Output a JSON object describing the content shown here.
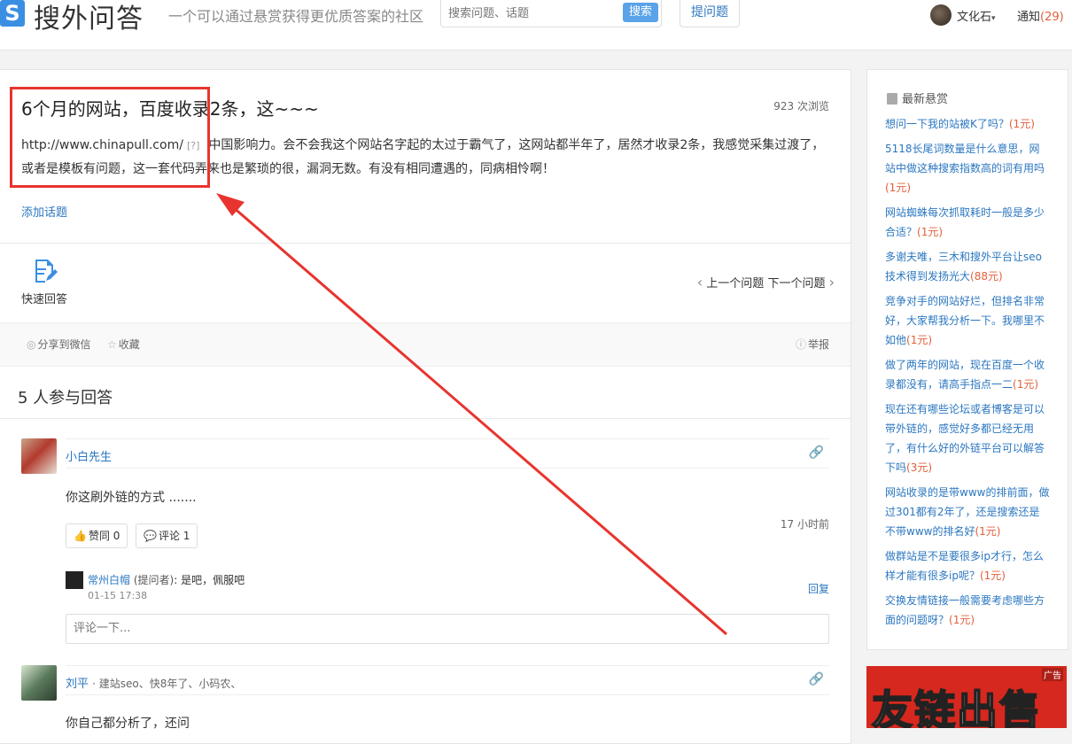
{
  "header": {
    "logo_mark": "S",
    "logo_text": "搜外问答",
    "slogan": "一个可以通过悬赏获得更优质答案的社区",
    "search_placeholder": "搜索问题、话题",
    "search_button": "搜索",
    "ask_button": "提问题",
    "user_name": "文化石",
    "notify_label": "通知",
    "notify_count": "(29)"
  },
  "question": {
    "title": "6个月的网站，百度收录2条，这~~~",
    "views": "923 次浏览",
    "url": "http://www.chinapull.com/",
    "help_tag": "[?]",
    "body": "中国影响力。会不会我这个网站名字起的太过于霸气了，这网站都半年了，居然才收录2条，我感觉采集过渡了，或者是模板有问题，这一套代码弄来也是繁琐的很，漏洞无数。有没有相同遭遇的，同病相怜啊！",
    "add_topic": "添加话题",
    "quick_answer": "快速回答",
    "prev_question": "上一个问题",
    "next_question": "下一个问题",
    "share_wechat": "分享到微信",
    "favorite": "收藏",
    "report": "举报"
  },
  "answers": {
    "count_label": "5 人参与回答",
    "items": [
      {
        "name": "小白先生",
        "text": "你这刷外链的方式 .......",
        "like_label": "赞同 0",
        "comment_label": "评论 1",
        "time": "17 小时前",
        "comment": {
          "name": "常州白帽",
          "role": "(提问者)",
          "text": ": 是吧，佩服吧",
          "time": "01-15 17:38",
          "reply": "回复"
        },
        "comment_placeholder": "评论一下..."
      },
      {
        "name": "刘平",
        "sig": "建站seo、快8年了、小码农、",
        "text": "你自己都分析了，还问"
      }
    ]
  },
  "sidebar": {
    "title": "最新悬赏",
    "items": [
      {
        "text": "想问一下我的站被K了吗？",
        "reward": "(1元)"
      },
      {
        "text": "5118长尾词数量是什么意思，网站中做这种搜索指数高的词有用吗",
        "reward": "(1元)"
      },
      {
        "text": "网站蜘蛛每次抓取耗时一般是多少合适？",
        "reward": "(1元)"
      },
      {
        "text": "多谢夫唯，三木和搜外平台让seo技术得到发扬光大",
        "reward": "(88元)"
      },
      {
        "text": "竞争对手的网站好烂，但排名非常好，大家帮我分析一下。我哪里不如他",
        "reward": "(1元)"
      },
      {
        "text": "做了两年的网站，现在百度一个收录都没有，请高手指点一二",
        "reward": "(1元)"
      },
      {
        "text": "现在还有哪些论坛或者博客是可以带外链的，感觉好多都已经无用了，有什么好的外链平台可以解答下吗",
        "reward": "(3元)"
      },
      {
        "text": "网站收录的是带www的排前面，做过301都有2年了，还是搜索还是不带www的排名好",
        "reward": "(1元)"
      },
      {
        "text": "做群站是不是要很多ip才行，怎么样才能有很多ip呢？",
        "reward": "(1元)"
      },
      {
        "text": "交换友情链接一般需要考虑哪些方面的问题呀？",
        "reward": "(1元)"
      }
    ],
    "ad_text": "友链出售",
    "ad_tag": "广告"
  }
}
